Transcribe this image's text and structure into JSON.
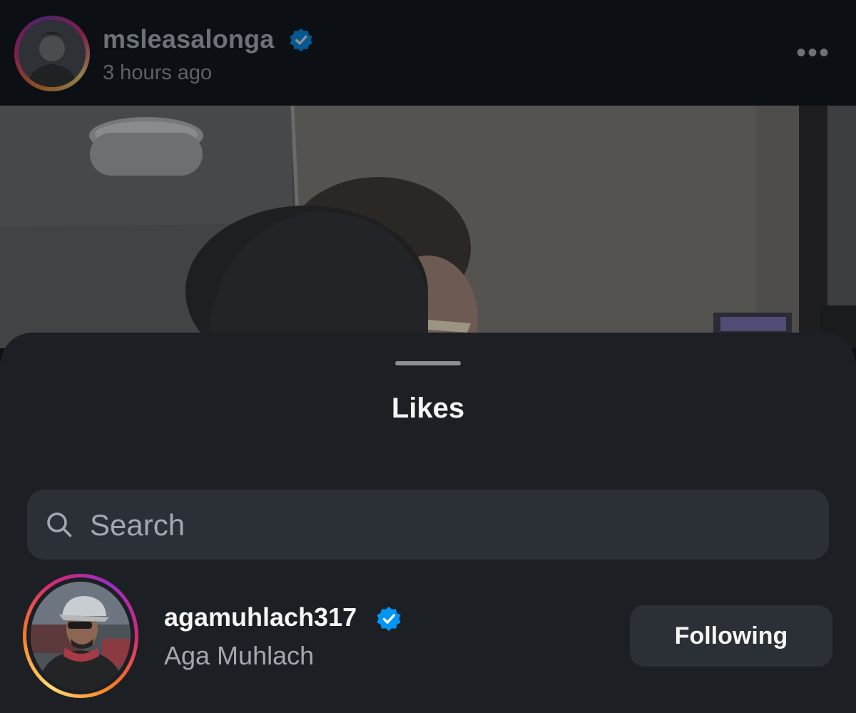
{
  "post": {
    "author_username": "msleasalonga",
    "time_ago": "3 hours ago",
    "verified": true
  },
  "likes_sheet": {
    "title": "Likes",
    "search_placeholder": "Search",
    "users": [
      {
        "username": "agamuhlach317",
        "full_name": "Aga Muhlach",
        "verified": true,
        "follow_state_label": "Following"
      }
    ]
  },
  "colors": {
    "background": "#0c1014",
    "sheet": "#1c1f24",
    "field": "#2b2f36",
    "verified_blue": "#0095f6",
    "secondary_text": "#a3a8b0"
  },
  "icons": {
    "more": "more-horizontal-icon",
    "search": "search-icon",
    "verified": "verified-badge-icon"
  }
}
